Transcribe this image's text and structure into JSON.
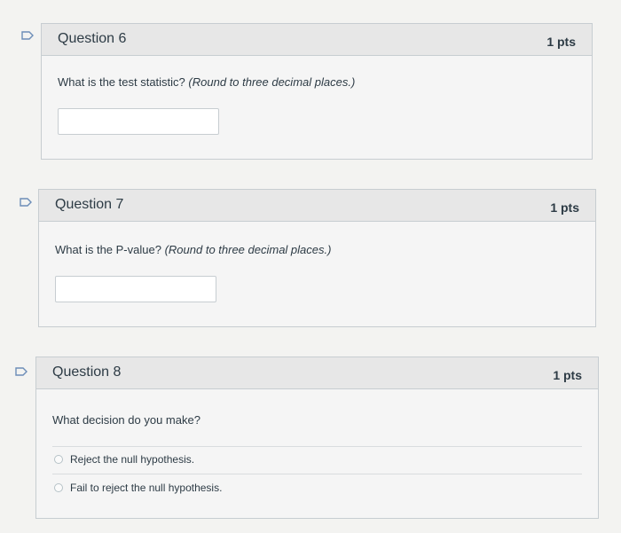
{
  "questions": [
    {
      "title": "Question 6",
      "points": "1 pts",
      "prompt": "What is the test statistic?",
      "prompt_hint": "(Round to three decimal places.)",
      "answer_value": ""
    },
    {
      "title": "Question 7",
      "points": "1 pts",
      "prompt": "What is the P-value?",
      "prompt_hint": "(Round to three decimal places.)",
      "answer_value": ""
    },
    {
      "title": "Question 8",
      "points": "1 pts",
      "prompt": "What decision do you make?",
      "options": [
        "Reject the null hypothesis.",
        "Fail to reject the null hypothesis."
      ]
    }
  ],
  "colors": {
    "flag": "#6c8db8",
    "header_bg": "#e7e7e7",
    "border": "#c7cdd1"
  },
  "icons": {
    "flag": "flag-icon",
    "radio": "radio-button"
  }
}
